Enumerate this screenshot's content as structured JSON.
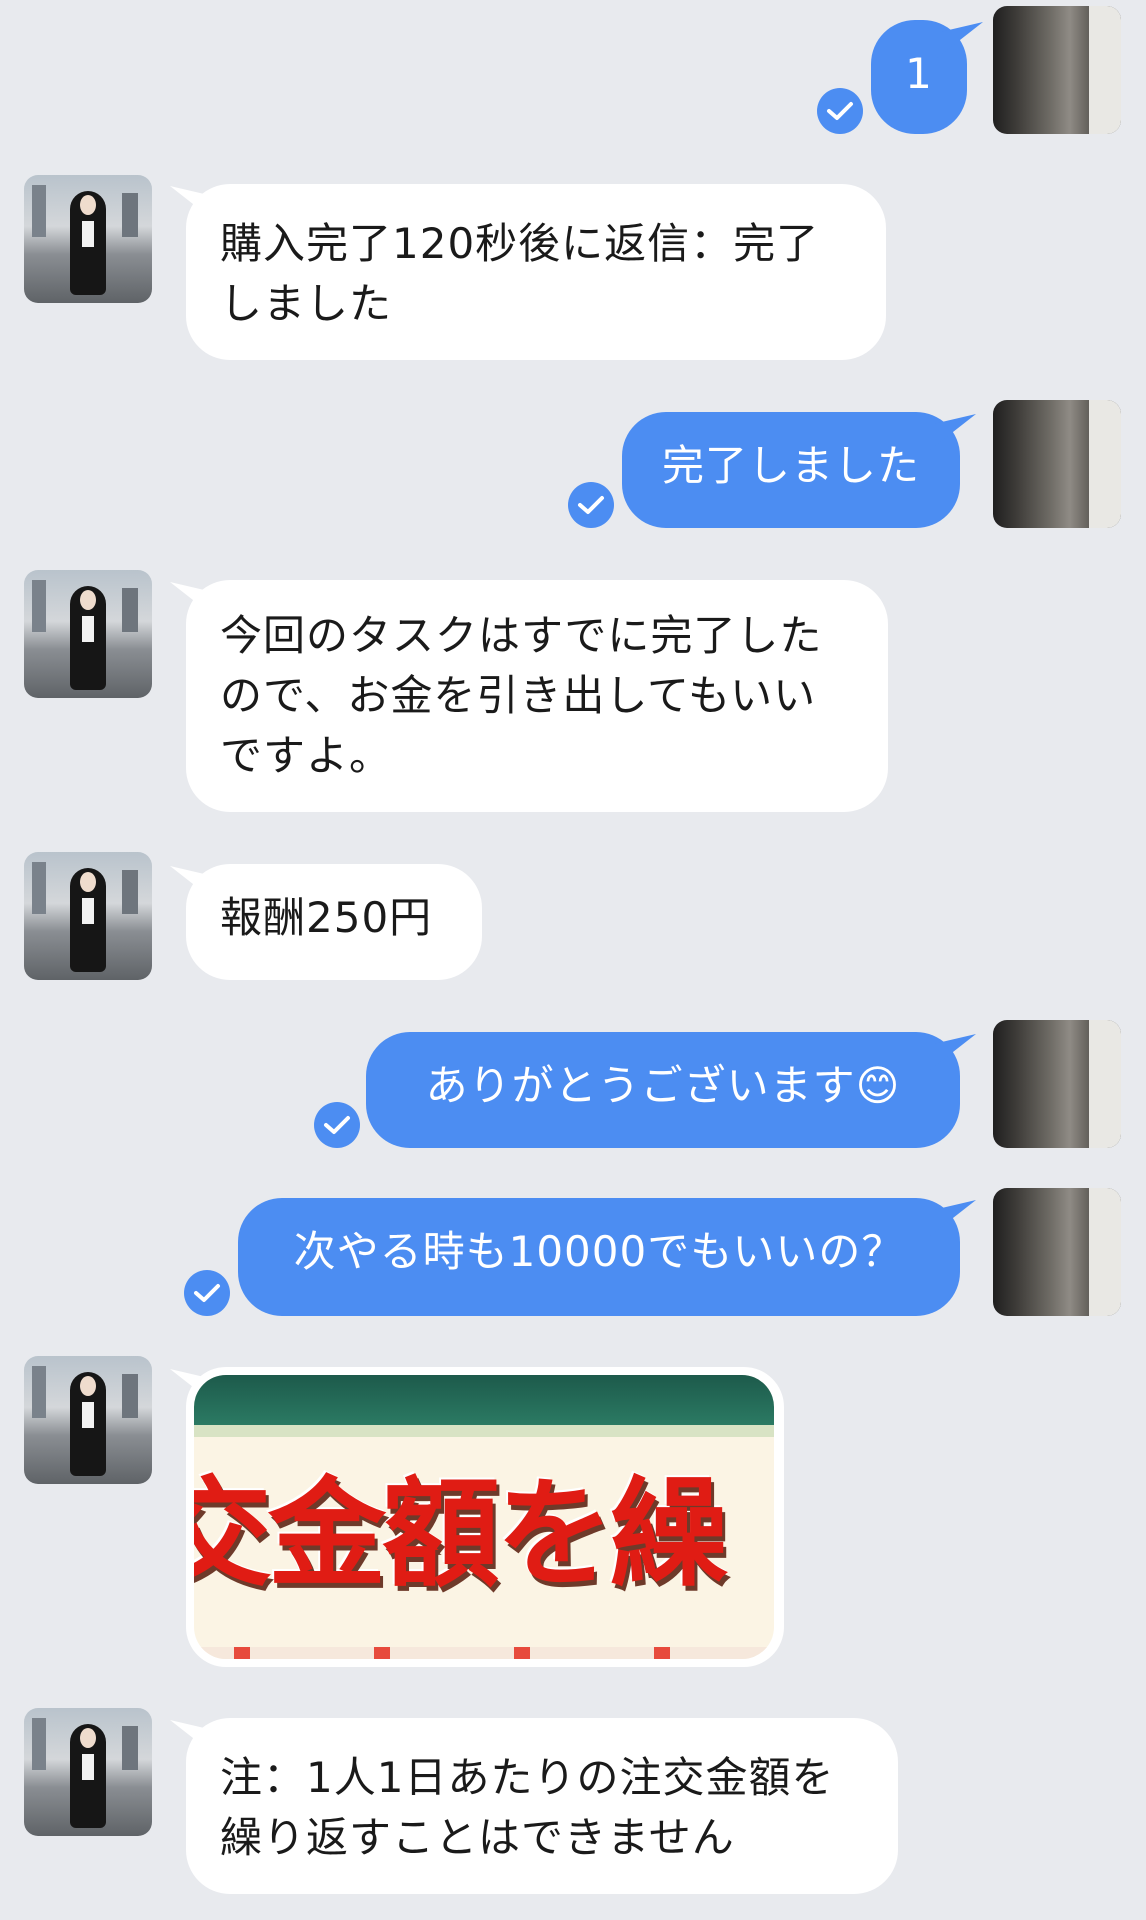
{
  "chat": {
    "messages": [
      {
        "sender": "me",
        "type": "text",
        "text": "1",
        "read": true
      },
      {
        "sender": "her",
        "type": "text",
        "text": "購入完了120秒後に返信：完了しました"
      },
      {
        "sender": "me",
        "type": "text",
        "text": "完了しました",
        "read": true
      },
      {
        "sender": "her",
        "type": "text",
        "text": "今回のタスクはすでに完了したので、お金を引き出してもいいですよ。"
      },
      {
        "sender": "her",
        "type": "text",
        "text": "報酬250円"
      },
      {
        "sender": "me",
        "type": "text",
        "text": "ありがとうございます😊",
        "read": true
      },
      {
        "sender": "me",
        "type": "text",
        "text": "次やる時も10000でもいいの？",
        "read": true
      },
      {
        "sender": "her",
        "type": "image",
        "image_text": "交金額を繰"
      },
      {
        "sender": "her",
        "type": "text",
        "text": "注：1人1日あたりの注交金額を繰り返すことはできません"
      }
    ]
  },
  "colors": {
    "background": "#e8eaee",
    "outgoing_bubble": "#4c8df2",
    "incoming_bubble": "#ffffff",
    "read_check": "#4c8df2"
  },
  "icons": {
    "read_receipt": "check-circle-icon"
  }
}
